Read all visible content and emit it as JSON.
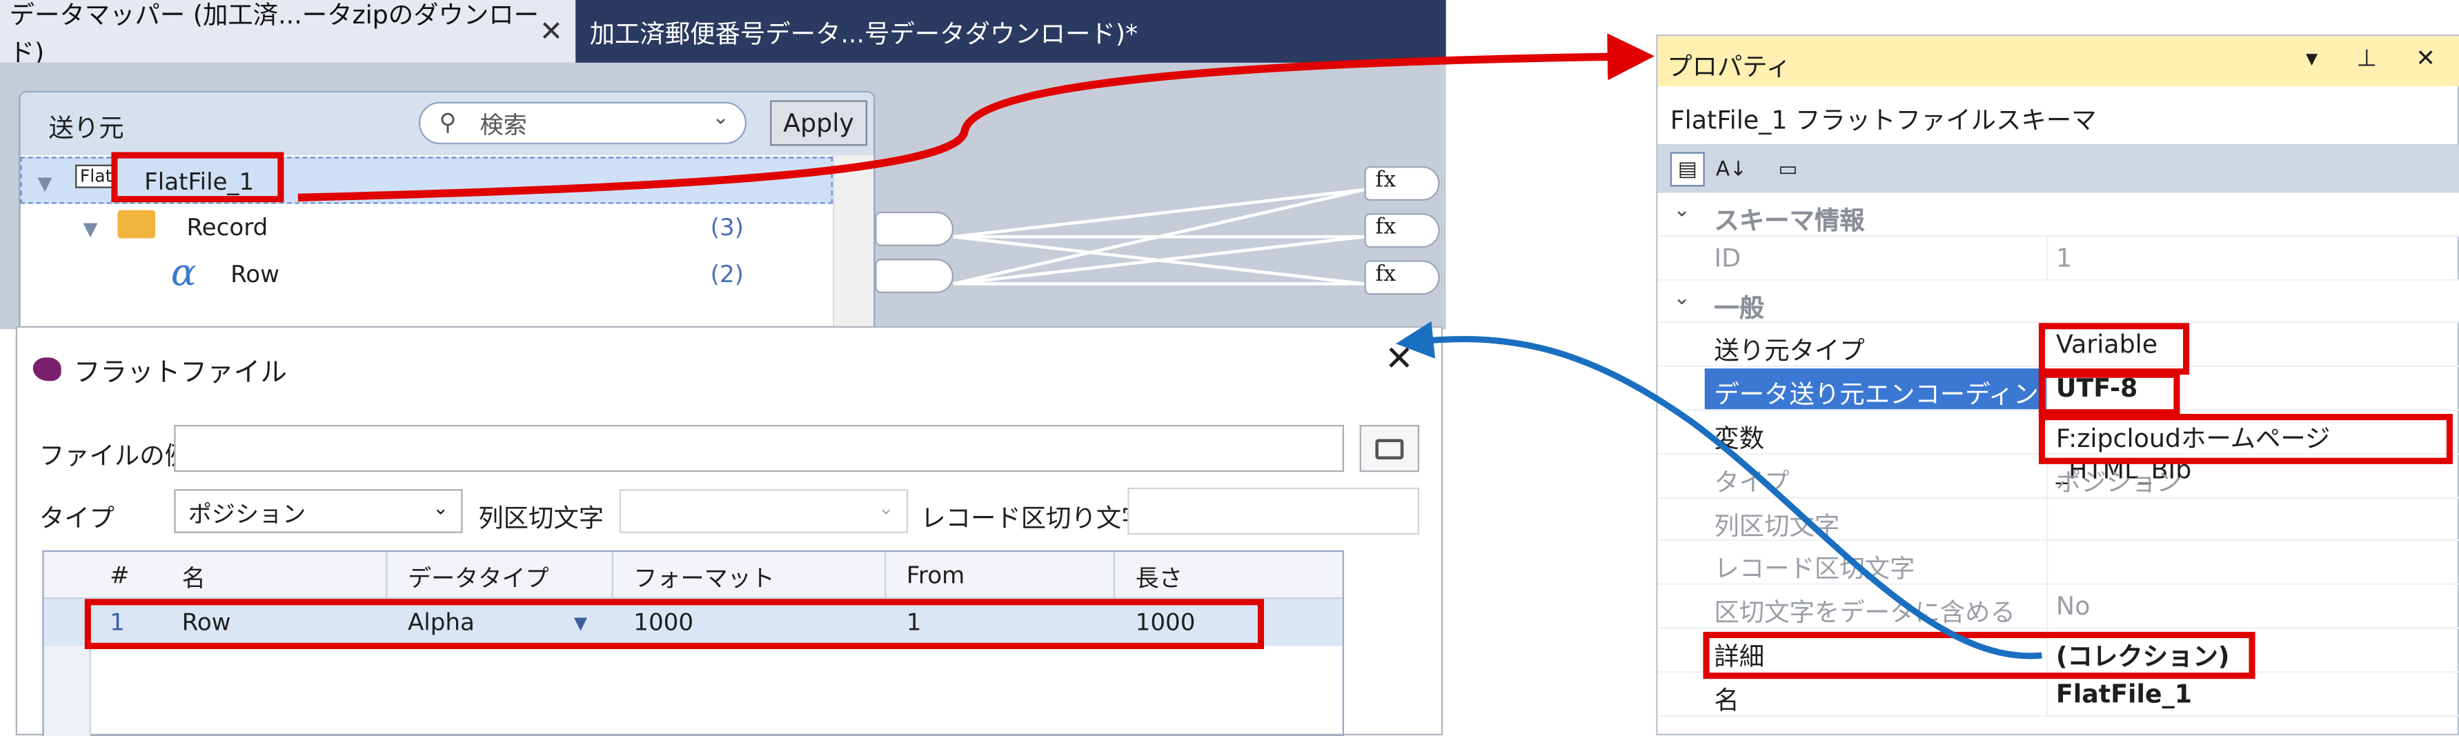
{
  "tabs": [
    {
      "label": "データマッパー (加工済...ータzipのダウンロード)",
      "close": "✕"
    },
    {
      "label": "加工済郵便番号データ...号データダウンロード)*"
    }
  ],
  "source": {
    "title": "送り元",
    "search_placeholder": "検索",
    "apply": "Apply",
    "tree": [
      {
        "name": "FlatFile_1",
        "count": ""
      },
      {
        "name": "Record",
        "count": "(3)"
      },
      {
        "name": "Row",
        "count": "(2)"
      }
    ]
  },
  "fx": "fx",
  "flat": {
    "title": "フラットファイル",
    "close": "✕",
    "file_label": "ファイルの例",
    "file_value": "",
    "type_label": "タイプ",
    "type_value": "ポジション",
    "col_sep_label": "列区切文字",
    "rec_sep_label": "レコード区切り文字",
    "columns": [
      "#",
      "名",
      "データタイプ",
      "フォーマット",
      "From",
      "長さ"
    ],
    "rows": [
      [
        "1",
        "Row",
        "Alpha",
        "1000",
        "1",
        "1000"
      ]
    ]
  },
  "props": {
    "title": "プロパティ",
    "object": "FlatFile_1 フラットファイルスキーマ",
    "rows": [
      {
        "cat": true,
        "k": "スキーマ情報"
      },
      {
        "k": "ID",
        "v": "1",
        "gray": true
      },
      {
        "cat": true,
        "k": "一般"
      },
      {
        "k": "送り元タイプ",
        "v": "Variable"
      },
      {
        "k": "データ送り元エンコーディング",
        "v": "UTF-8",
        "sel": true,
        "bold": true
      },
      {
        "k": "変数",
        "v": "F:zipcloudホームページ_HTML_BIb"
      },
      {
        "k": "タイプ",
        "v": "ポジション",
        "gray": true
      },
      {
        "k": "列区切文字",
        "v": "",
        "gray": true
      },
      {
        "k": "レコード区切文字",
        "v": "",
        "gray": true
      },
      {
        "k": "区切文字をデータに含める",
        "v": "No",
        "gray": true
      },
      {
        "k": "詳細",
        "v": "(コレクション)",
        "bold": true
      },
      {
        "k": "名",
        "v": "FlatFile_1",
        "bold": true
      }
    ]
  },
  "colors": {
    "accent": "#3b78d4",
    "highlight": "#e00000",
    "arrow_blue": "#1a6fc0",
    "title_yellow": "#fff0b2"
  }
}
